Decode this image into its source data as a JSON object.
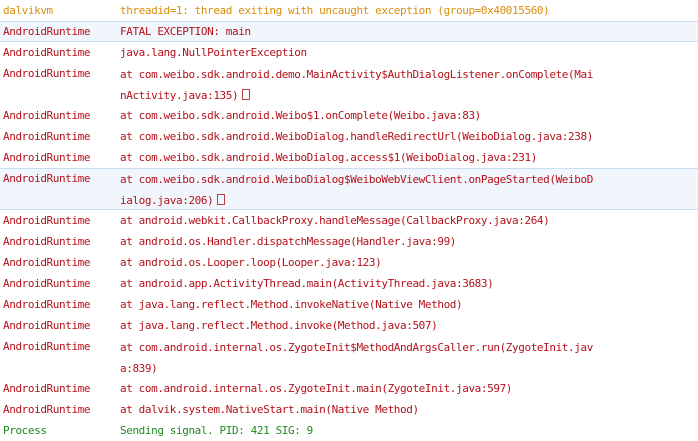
{
  "log": {
    "rows": [
      {
        "level": "warn",
        "tag": "dalvikvm",
        "msg": "threadid=1: thread exiting with uncaught exception (group=0x40015560)"
      },
      {
        "level": "error",
        "tag": "AndroidRuntime",
        "msg": "FATAL EXCEPTION: main"
      },
      {
        "level": "error",
        "tag": "AndroidRuntime",
        "msg": "java.lang.NullPointerException"
      },
      {
        "level": "error",
        "tag": "AndroidRuntime",
        "msg": "at com.weibo.sdk.android.demo.MainActivity$AuthDialogListener.onComplete(Mai\nnActivity.java:135)",
        "wrapped": true
      },
      {
        "level": "error",
        "tag": "AndroidRuntime",
        "msg": "at com.weibo.sdk.android.Weibo$1.onComplete(Weibo.java:83)"
      },
      {
        "level": "error",
        "tag": "AndroidRuntime",
        "msg": "at com.weibo.sdk.android.WeiboDialog.handleRedirectUrl(WeiboDialog.java:238)"
      },
      {
        "level": "error",
        "tag": "AndroidRuntime",
        "msg": "at com.weibo.sdk.android.WeiboDialog.access$1(WeiboDialog.java:231)"
      },
      {
        "level": "error",
        "tag": "AndroidRuntime",
        "msg": "at com.weibo.sdk.android.WeiboDialog$WeiboWebViewClient.onPageStarted(WeiboD\nialog.java:206)",
        "wrapped": true
      },
      {
        "level": "error",
        "tag": "AndroidRuntime",
        "msg": "at android.webkit.CallbackProxy.handleMessage(CallbackProxy.java:264)"
      },
      {
        "level": "error",
        "tag": "AndroidRuntime",
        "msg": "at android.os.Handler.dispatchMessage(Handler.java:99)"
      },
      {
        "level": "error",
        "tag": "AndroidRuntime",
        "msg": "at android.os.Looper.loop(Looper.java:123)"
      },
      {
        "level": "error",
        "tag": "AndroidRuntime",
        "msg": "at android.app.ActivityThread.main(ActivityThread.java:3683)"
      },
      {
        "level": "error",
        "tag": "AndroidRuntime",
        "msg": "at java.lang.reflect.Method.invokeNative(Native Method)"
      },
      {
        "level": "error",
        "tag": "AndroidRuntime",
        "msg": "at java.lang.reflect.Method.invoke(Method.java:507)"
      },
      {
        "level": "error",
        "tag": "AndroidRuntime",
        "msg": "at com.android.internal.os.ZygoteInit$MethodAndArgsCaller.run(ZygoteInit.jav\na:839)",
        "wrapped": true
      },
      {
        "level": "error",
        "tag": "AndroidRuntime",
        "msg": "at com.android.internal.os.ZygoteInit.main(ZygoteInit.java:597)"
      },
      {
        "level": "error",
        "tag": "AndroidRuntime",
        "msg": "at dalvik.system.NativeStart.main(Native Method)"
      },
      {
        "level": "info",
        "tag": "Process",
        "msg": "Sending signal. PID: 421 SIG: 9"
      }
    ]
  }
}
